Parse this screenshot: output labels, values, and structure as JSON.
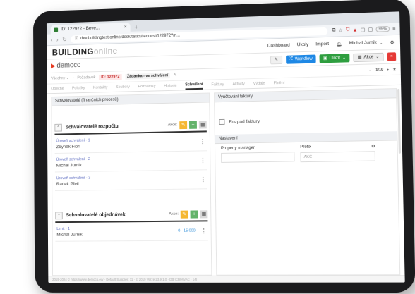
{
  "browser": {
    "tab_title": "ID: 122972 - Beve...",
    "tab_close": "×",
    "new_tab": "+",
    "url": "dev.buildingtest.online/desk/tasks/request/122972?m...",
    "zoom": "99%"
  },
  "app": {
    "logo_bold": "BUILDING",
    "logo_light": "online",
    "nav": {
      "dashboard": "Dashboard",
      "tasks": "Úkoly",
      "import": "Import",
      "user": "Michal Jurnik"
    }
  },
  "brand": {
    "name": "democo",
    "workflow_label": "Workflow",
    "save_label": "Uložit",
    "actions_label": "Akce",
    "close_label": "×"
  },
  "breadcrumb": {
    "items": [
      "Všechny ⌄",
      "Požadavek"
    ],
    "id": "ID: 122972",
    "request": "Žádanka - ve schválení",
    "pager": "1/10"
  },
  "tabs": [
    "Obecné",
    "Položky",
    "Kontakty",
    "Soubory",
    "Poznámky",
    "Historie",
    "Schválení",
    "Faktury",
    "Aktivity",
    "Výdaje",
    "Plnění"
  ],
  "active_tab_index": 6,
  "left": {
    "section_title": "Schvalovatelé (finančních procesů)",
    "groups": [
      {
        "title": "Schvalovatelé rozpočtu",
        "tools_label": "Akce:",
        "rows": [
          {
            "label": "Úroveň schválení · 1",
            "value": "Zbyněk Fiori"
          },
          {
            "label": "Úroveň schválení · 2",
            "value": "Michal Jurnik"
          },
          {
            "label": "Úroveň schválení · 3",
            "value": "Radek Pfeil"
          }
        ]
      },
      {
        "title": "Schvalovatelé objednávek",
        "tools_label": "Akce:",
        "rows": [
          {
            "label": "Limit · 1",
            "value": "Michal Jurnik",
            "range": "0 - 15 000"
          }
        ]
      }
    ]
  },
  "right": {
    "section1_title": "Vyúčtování faktury",
    "checkbox_label": "Rozpad faktury",
    "section2_title": "Nastavení",
    "field1_label": "Property manager",
    "field2_label": "Prefix",
    "field2_value": "AKC"
  },
  "footer": "2015-2024 © https://www.democo.eu/ · Default Supplier: 11 · © 2019 Verze 23.9.1.0 · DB [CB04VAC · 14]",
  "icons": {
    "lock": "lock-icon",
    "shield": "shield-icon",
    "bell": "bell-icon",
    "user": "user-icon"
  }
}
